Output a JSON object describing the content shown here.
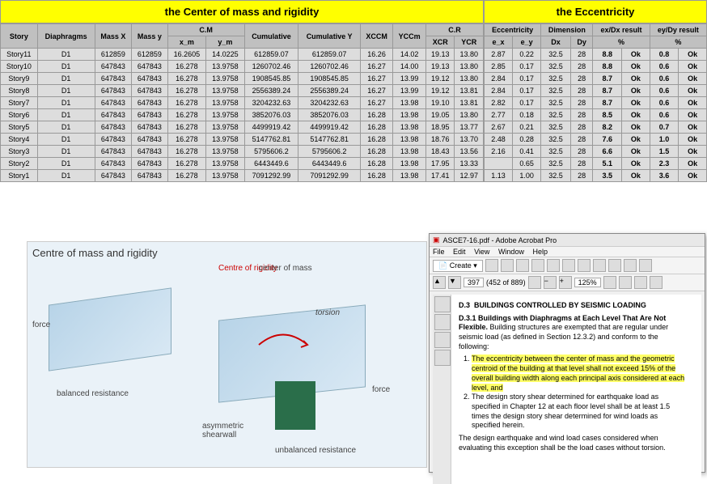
{
  "titles": {
    "left": "the Center of mass and rigidity",
    "right": "the Eccentricity"
  },
  "leftHeaders": {
    "story": "Story",
    "diaph": "Diaphragms",
    "massx": "Mass X",
    "massy": "Mass y",
    "cm": "C.M",
    "xm": "x_m",
    "ym": "y_m",
    "cumx": "Cumulative",
    "cumy": "Cumulative Y",
    "xccm": "XCCM",
    "yccm": "YCCm",
    "cr": "C.R",
    "xcr": "XCR",
    "ycr": "YCR"
  },
  "rightHeaders": {
    "ecc": "Eccentricity",
    "dim": "Dimension",
    "res1": "ex/Dx result",
    "res2": "ey/Dy result",
    "ex": "e_x",
    "ey": "e_y",
    "dx": "Dx",
    "dy": "Dy",
    "pct": "%"
  },
  "rows": [
    {
      "s": "Story11",
      "d": "D1",
      "mx": "612859",
      "my": "612859",
      "xm": "16.2605",
      "ym": "14.0225",
      "cx": "612859.07",
      "cy": "612859.07",
      "xc": "16.26",
      "yc": "14.02",
      "xcr": "19.13",
      "ycr": "13.80",
      "ex": "2.87",
      "ey": "0.22",
      "dxx": "32.5",
      "dyy": "28",
      "r1": "8.8",
      "r2": "0.8"
    },
    {
      "s": "Story10",
      "d": "D1",
      "mx": "647843",
      "my": "647843",
      "xm": "16.278",
      "ym": "13.9758",
      "cx": "1260702.46",
      "cy": "1260702.46",
      "xc": "16.27",
      "yc": "14.00",
      "xcr": "19.13",
      "ycr": "13.80",
      "ex": "2.85",
      "ey": "0.17",
      "dxx": "32.5",
      "dyy": "28",
      "r1": "8.8",
      "r2": "0.6"
    },
    {
      "s": "Story9",
      "d": "D1",
      "mx": "647843",
      "my": "647843",
      "xm": "16.278",
      "ym": "13.9758",
      "cx": "1908545.85",
      "cy": "1908545.85",
      "xc": "16.27",
      "yc": "13.99",
      "xcr": "19.12",
      "ycr": "13.80",
      "ex": "2.84",
      "ey": "0.17",
      "dxx": "32.5",
      "dyy": "28",
      "r1": "8.7",
      "r2": "0.6"
    },
    {
      "s": "Story8",
      "d": "D1",
      "mx": "647843",
      "my": "647843",
      "xm": "16.278",
      "ym": "13.9758",
      "cx": "2556389.24",
      "cy": "2556389.24",
      "xc": "16.27",
      "yc": "13.99",
      "xcr": "19.12",
      "ycr": "13.81",
      "ex": "2.84",
      "ey": "0.17",
      "dxx": "32.5",
      "dyy": "28",
      "r1": "8.7",
      "r2": "0.6"
    },
    {
      "s": "Story7",
      "d": "D1",
      "mx": "647843",
      "my": "647843",
      "xm": "16.278",
      "ym": "13.9758",
      "cx": "3204232.63",
      "cy": "3204232.63",
      "xc": "16.27",
      "yc": "13.98",
      "xcr": "19.10",
      "ycr": "13.81",
      "ex": "2.82",
      "ey": "0.17",
      "dxx": "32.5",
      "dyy": "28",
      "r1": "8.7",
      "r2": "0.6"
    },
    {
      "s": "Story6",
      "d": "D1",
      "mx": "647843",
      "my": "647843",
      "xm": "16.278",
      "ym": "13.9758",
      "cx": "3852076.03",
      "cy": "3852076.03",
      "xc": "16.28",
      "yc": "13.98",
      "xcr": "19.05",
      "ycr": "13.80",
      "ex": "2.77",
      "ey": "0.18",
      "dxx": "32.5",
      "dyy": "28",
      "r1": "8.5",
      "r2": "0.6"
    },
    {
      "s": "Story5",
      "d": "D1",
      "mx": "647843",
      "my": "647843",
      "xm": "16.278",
      "ym": "13.9758",
      "cx": "4499919.42",
      "cy": "4499919.42",
      "xc": "16.28",
      "yc": "13.98",
      "xcr": "18.95",
      "ycr": "13.77",
      "ex": "2.67",
      "ey": "0.21",
      "dxx": "32.5",
      "dyy": "28",
      "r1": "8.2",
      "r2": "0.7"
    },
    {
      "s": "Story4",
      "d": "D1",
      "mx": "647843",
      "my": "647843",
      "xm": "16.278",
      "ym": "13.9758",
      "cx": "5147762.81",
      "cy": "5147762.81",
      "xc": "16.28",
      "yc": "13.98",
      "xcr": "18.76",
      "ycr": "13.70",
      "ex": "2.48",
      "ey": "0.28",
      "dxx": "32.5",
      "dyy": "28",
      "r1": "7.6",
      "r2": "1.0"
    },
    {
      "s": "Story3",
      "d": "D1",
      "mx": "647843",
      "my": "647843",
      "xm": "16.278",
      "ym": "13.9758",
      "cx": "5795606.2",
      "cy": "5795606.2",
      "xc": "16.28",
      "yc": "13.98",
      "xcr": "18.43",
      "ycr": "13.56",
      "ex": "2.16",
      "ey": "0.41",
      "dxx": "32.5",
      "dyy": "28",
      "r1": "6.6",
      "r2": "1.5"
    },
    {
      "s": "Story2",
      "d": "D1",
      "mx": "647843",
      "my": "647843",
      "xm": "16.278",
      "ym": "13.9758",
      "cx": "6443449.6",
      "cy": "6443449.6",
      "xc": "16.28",
      "yc": "13.98",
      "xcr": "17.95",
      "ycr": "13.33",
      "ex": "",
      "ey": "0.65",
      "dxx": "32.5",
      "dyy": "28",
      "r1": "5.1",
      "r2": "2.3"
    },
    {
      "s": "Story1",
      "d": "D1",
      "mx": "647843",
      "my": "647843",
      "xm": "16.278",
      "ym": "13.9758",
      "cx": "7091292.99",
      "cy": "7091292.99",
      "xc": "16.28",
      "yc": "13.98",
      "xcr": "17.41",
      "ycr": "12.97",
      "ex": "1.13",
      "ey": "1.00",
      "dxx": "32.5",
      "dyy": "28",
      "r1": "3.5",
      "r2": "3.6"
    }
  ],
  "ok": "Ok",
  "diagram": {
    "title": "Centre of mass and  rigidity",
    "cor": "Centre of rigidity",
    "com": "center of mass",
    "force": "force",
    "torsion": "torsion",
    "balanced": "balanced resistance",
    "asym": "asymmetric\nshearwall",
    "unbal": "unbalanced resistance"
  },
  "acrobat": {
    "title": "ASCE7-16.pdf - Adobe Acrobat Pro",
    "menu": [
      "File",
      "Edit",
      "View",
      "Window",
      "Help"
    ],
    "create": "Create",
    "page": "397",
    "total": "(452 of 889)",
    "zoom": "125%",
    "h1": "D.3",
    "h1t": "BUILDINGS CONTROLLED BY SEISMIC LOADING",
    "h2": "D.3.1 Buildings with Diaphragms at Each Level That Are Not Flexible.",
    "p1": "Building structures are exempted that are regular under seismic load (as defined in Section 12.3.2) and conform to the following:",
    "li1a": "The ",
    "li1hl": "eccentricity",
    "li1b": " between the center of mass and the geometric centroid of the building at that level shall not exceed 15% of the overall building width along each principal axis considered at each level, and",
    "li2": "The design story shear determined for earthquake load as specified in Chapter 12 at each floor level shall be at least 1.5 times the design story shear determined for wind loads as specified herein.",
    "p2": "The design earthquake and wind load cases considered when evaluating this exception shall be the load cases without torsion."
  }
}
